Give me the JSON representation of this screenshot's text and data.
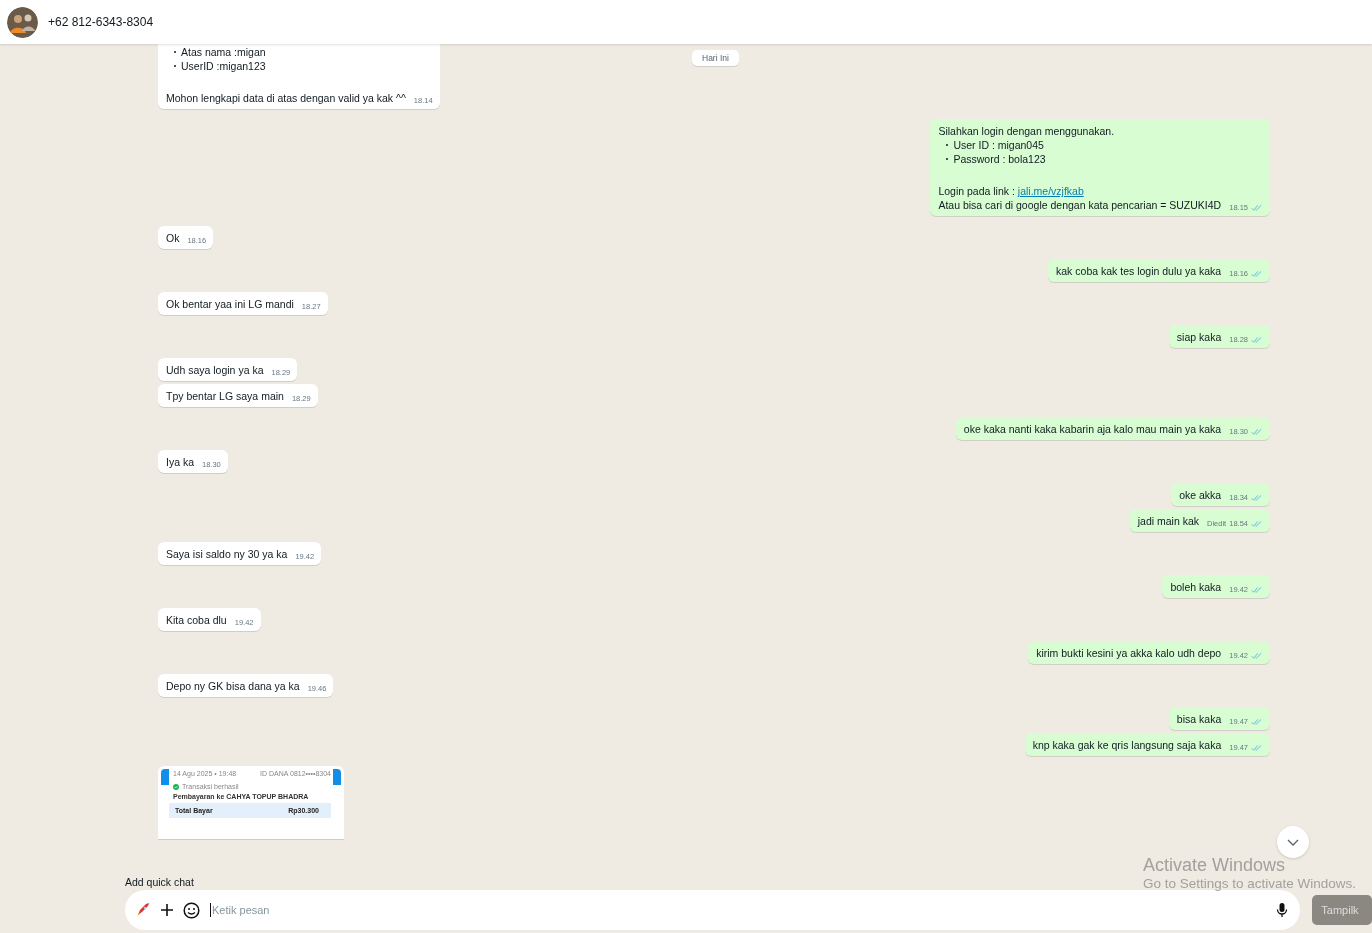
{
  "header": {
    "contact_name": "+62 812-6343-8304"
  },
  "date_chip": "Hari Ini",
  "groups": [
    {
      "outgoing": false,
      "messages": [
        {
          "kind": "text",
          "blocks": [
            {
              "kind": "bullets",
              "items": [
                "Atas nama :migan",
                "UserID :migan123"
              ]
            },
            {
              "kind": "blank"
            },
            {
              "kind": "text",
              "text": "Mohon lengkapi data di atas dengan valid ya kak ^^"
            }
          ],
          "time": "18.14"
        }
      ]
    },
    {
      "outgoing": true,
      "messages": [
        {
          "kind": "text",
          "blocks": [
            {
              "kind": "text",
              "text": "Silahkan login dengan menggunakan."
            },
            {
              "kind": "bullets",
              "items": [
                "User ID : migan045",
                "Password : bola123"
              ]
            },
            {
              "kind": "blank"
            },
            {
              "kind": "text",
              "text": "Login pada link : ",
              "link": "jali.me/vzjfkab"
            },
            {
              "kind": "text",
              "text": "Atau bisa cari di google dengan kata pencarian = SUZUKI4D"
            }
          ],
          "time": "18.15",
          "read": true
        }
      ]
    },
    {
      "outgoing": false,
      "messages": [
        {
          "kind": "text",
          "blocks": [
            {
              "kind": "text",
              "text": "Ok"
            }
          ],
          "time": "18.16"
        }
      ]
    },
    {
      "outgoing": true,
      "messages": [
        {
          "kind": "text",
          "blocks": [
            {
              "kind": "text",
              "text": "kak coba kak tes login dulu ya kaka"
            }
          ],
          "time": "18.16",
          "read": true
        }
      ]
    },
    {
      "outgoing": false,
      "messages": [
        {
          "kind": "text",
          "blocks": [
            {
              "kind": "text",
              "text": "Ok bentar yaa ini LG mandi"
            }
          ],
          "time": "18.27"
        }
      ]
    },
    {
      "outgoing": true,
      "messages": [
        {
          "kind": "text",
          "blocks": [
            {
              "kind": "text",
              "text": "siap kaka"
            }
          ],
          "time": "18.28",
          "read": true
        }
      ]
    },
    {
      "outgoing": false,
      "messages": [
        {
          "kind": "text",
          "blocks": [
            {
              "kind": "text",
              "text": "Udh saya login ya ka"
            }
          ],
          "time": "18.29"
        },
        {
          "kind": "text",
          "blocks": [
            {
              "kind": "text",
              "text": "Tpy bentar LG saya main"
            }
          ],
          "time": "18.29"
        }
      ]
    },
    {
      "outgoing": true,
      "messages": [
        {
          "kind": "text",
          "blocks": [
            {
              "kind": "text",
              "text": "oke kaka nanti kaka kabarin aja kalo mau main ya kaka"
            }
          ],
          "time": "18.30",
          "read": true
        }
      ]
    },
    {
      "outgoing": false,
      "messages": [
        {
          "kind": "text",
          "blocks": [
            {
              "kind": "text",
              "text": "Iya ka"
            }
          ],
          "time": "18.30"
        }
      ]
    },
    {
      "outgoing": true,
      "messages": [
        {
          "kind": "text",
          "blocks": [
            {
              "kind": "text",
              "text": "oke akka"
            }
          ],
          "time": "18.34",
          "read": true
        },
        {
          "kind": "text",
          "blocks": [
            {
              "kind": "text",
              "text": "jadi main kak"
            }
          ],
          "time": "18.54",
          "edited_label": "Diedit",
          "read": true
        }
      ]
    },
    {
      "outgoing": false,
      "messages": [
        {
          "kind": "text",
          "blocks": [
            {
              "kind": "text",
              "text": "Saya isi saldo ny 30 ya ka"
            }
          ],
          "time": "19.42"
        }
      ]
    },
    {
      "outgoing": true,
      "messages": [
        {
          "kind": "text",
          "blocks": [
            {
              "kind": "text",
              "text": "boleh kaka"
            }
          ],
          "time": "19.42",
          "read": true
        }
      ]
    },
    {
      "outgoing": false,
      "messages": [
        {
          "kind": "text",
          "blocks": [
            {
              "kind": "text",
              "text": "Kita coba dlu"
            }
          ],
          "time": "19.42"
        }
      ]
    },
    {
      "outgoing": true,
      "messages": [
        {
          "kind": "text",
          "blocks": [
            {
              "kind": "text",
              "text": "kirim bukti kesini ya akka kalo udh depo"
            }
          ],
          "time": "19.42",
          "read": true
        }
      ]
    },
    {
      "outgoing": false,
      "messages": [
        {
          "kind": "text",
          "blocks": [
            {
              "kind": "text",
              "text": "Depo ny GK bisa dana ya ka"
            }
          ],
          "time": "19.46"
        }
      ]
    },
    {
      "outgoing": true,
      "messages": [
        {
          "kind": "text",
          "blocks": [
            {
              "kind": "text",
              "text": "bisa kaka"
            }
          ],
          "time": "19.47",
          "read": true
        },
        {
          "kind": "text",
          "blocks": [
            {
              "kind": "text",
              "text": "knp kaka gak ke qris langsung saja kaka"
            }
          ],
          "time": "19.47",
          "read": true
        }
      ]
    },
    {
      "outgoing": false,
      "messages": [
        {
          "kind": "image",
          "receipt": {
            "date": "14 Agu 2025 • 19:48",
            "account": "ID DANA 0812••••8304",
            "status": "Transaksi berhasil",
            "title": "Pembayaran ke CAHYA TOPUP BHADRA",
            "total_label": "Total Bayar",
            "total": "Rp30.300"
          }
        }
      ]
    }
  ],
  "quick_chat_label": "Add quick chat",
  "composer": {
    "placeholder": "Ketik pesan"
  },
  "side_button": "Tampilk",
  "os_notice": {
    "title": "Activate Windows",
    "subtitle": "Go to Settings to activate Windows."
  }
}
